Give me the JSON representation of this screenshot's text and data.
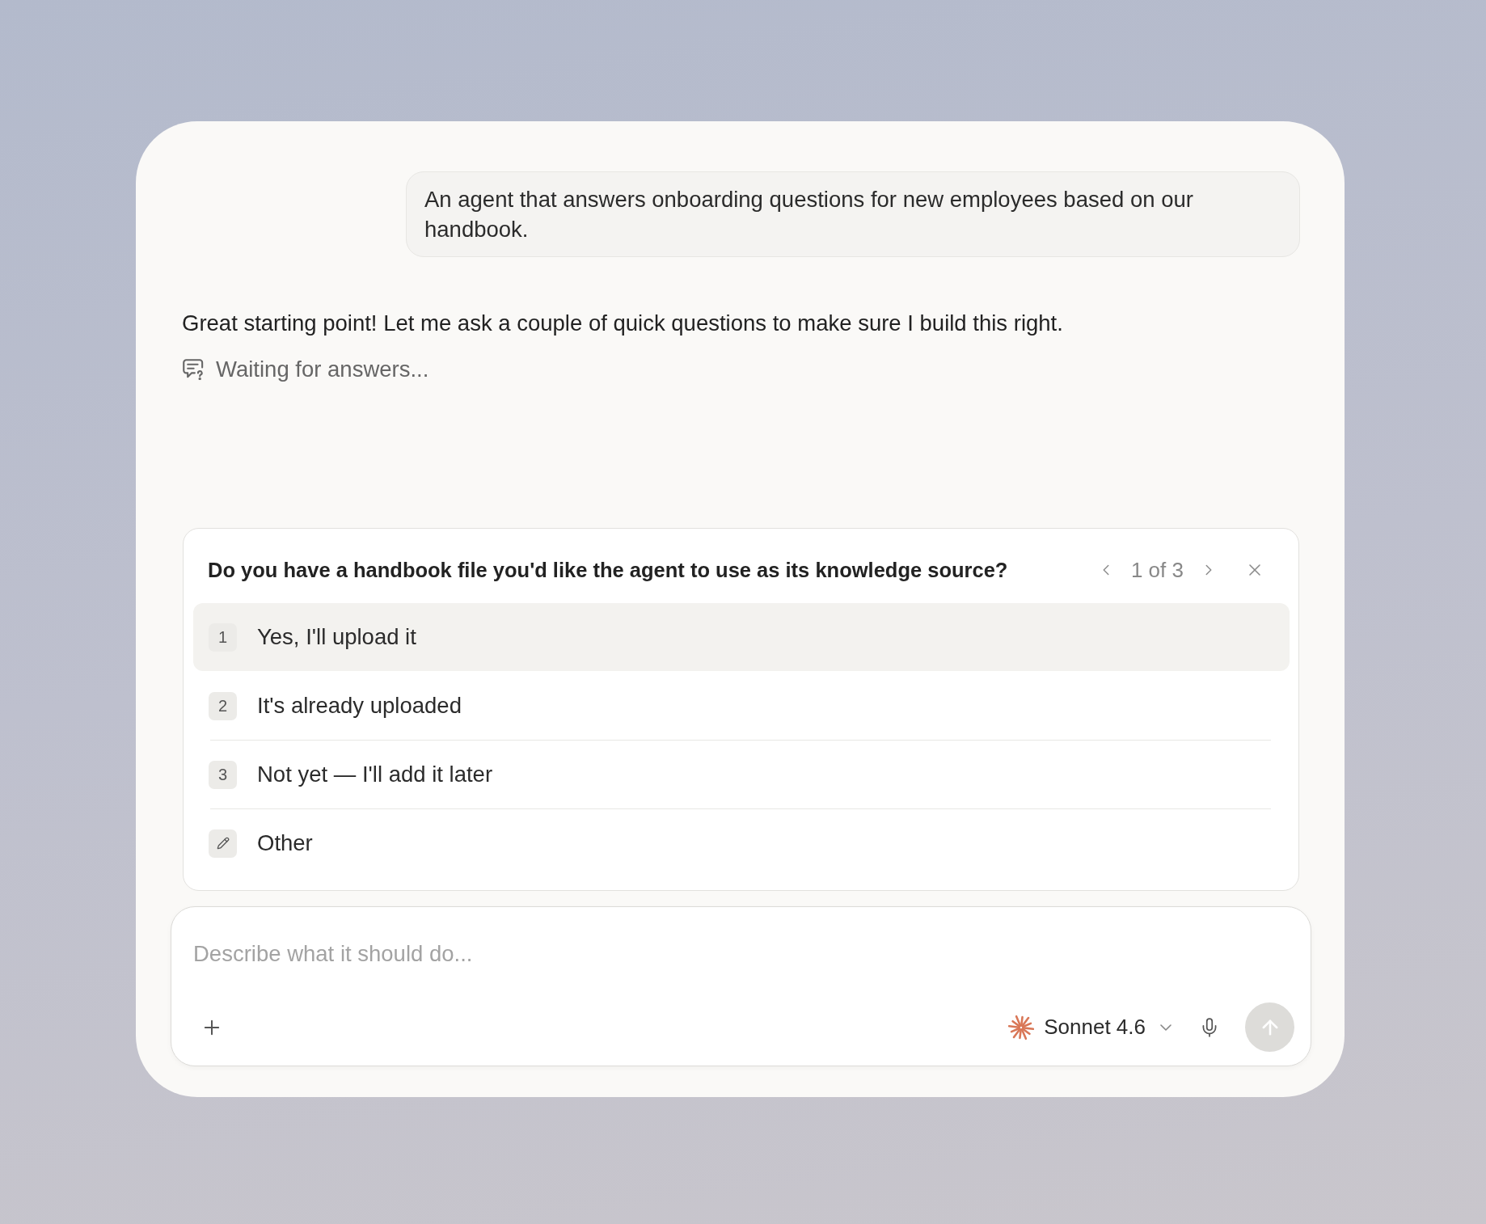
{
  "conversation": {
    "user_message": "An agent that answers onboarding questions for new employees based on our handbook.",
    "assistant_message": "Great starting point! Let me ask a couple of quick questions to make sure I build this right.",
    "status": "Waiting for answers..."
  },
  "question_card": {
    "question": "Do you have a handbook file you'd like the agent to use as its knowledge source?",
    "position": "1 of 3",
    "options": [
      {
        "kind": "numbered",
        "key": "1",
        "label": "Yes, I'll upload it",
        "selected": true
      },
      {
        "kind": "numbered",
        "key": "2",
        "label": "It's already uploaded",
        "selected": false
      },
      {
        "kind": "numbered",
        "key": "3",
        "label": "Not yet — I'll add it later",
        "selected": false
      },
      {
        "kind": "custom",
        "label": "Other",
        "selected": false
      }
    ]
  },
  "composer": {
    "placeholder": "Describe what it should do...",
    "model": "Sonnet 4.6",
    "send_disabled": true
  }
}
